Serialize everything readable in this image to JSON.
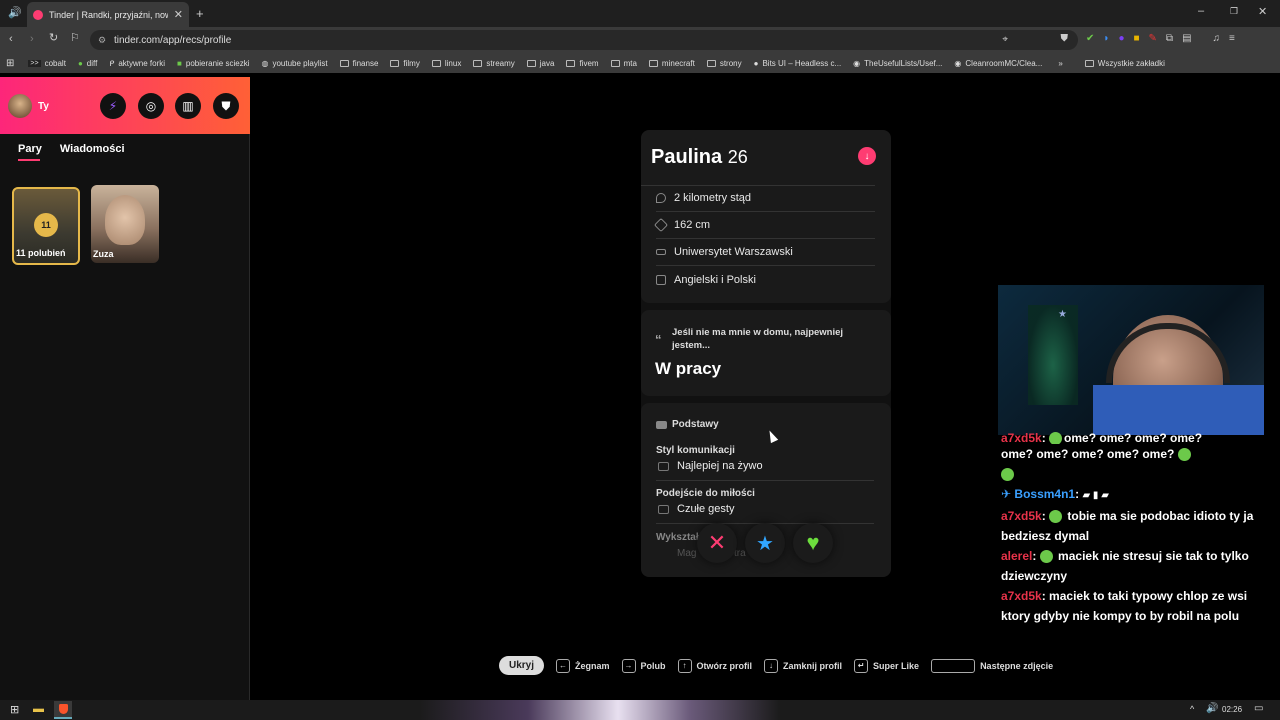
{
  "browser": {
    "tab_title": "Tinder | Randki, przyjaźni, nowe z",
    "url": "tinder.com/app/recs/profile",
    "bookmarks": [
      "cobalt",
      "diff",
      "aktywne forki",
      "pobieranie sciezki",
      "youtube playlist",
      "finanse",
      "filmy",
      "linux",
      "streamy",
      "java",
      "fivem",
      "mta",
      "minecraft",
      "strony",
      "Bits UI – Headless c...",
      "TheUsefulLists/Usef...",
      "CleanroomMC/Clea..."
    ],
    "all_bookmarks": "Wszystkie zakładki"
  },
  "sidebar": {
    "user_label": "Ty",
    "tabs": [
      "Pary",
      "Wiadomości"
    ],
    "likes_count": "11",
    "likes_label": "11 polubień",
    "match_name": "Zuza"
  },
  "profile": {
    "name": "Paulina",
    "age": "26",
    "details": [
      {
        "icon": "location-icon",
        "text": "2 kilometry stąd"
      },
      {
        "icon": "ruler-icon",
        "text": "162 cm"
      },
      {
        "icon": "school-icon",
        "text": "Uniwersytet Warszawski"
      },
      {
        "icon": "language-icon",
        "text": "Angielski i Polski"
      }
    ],
    "prompt_question": "Jeśli nie ma mnie w domu, najpewniej jestem...",
    "prompt_answer": "W pracy",
    "basics_title": "Podstawy",
    "basics": [
      {
        "label": "Styl komunikacji",
        "value": "Najlepiej na żywo"
      },
      {
        "label": "Podejście do miłości",
        "value": "Czułe gesty"
      }
    ],
    "partial_label": "Wykształ",
    "partial_value": "Mag",
    "partial_value_tail": "tra"
  },
  "hints": {
    "hide": "Ukryj",
    "nope": "Żegnam",
    "like": "Polub",
    "open": "Otwórz profil",
    "close": "Zamknij profil",
    "superlike": "Super Like",
    "next_photo": "Następne zdjęcie"
  },
  "chat": [
    {
      "user": "a7xd5k",
      "color": "#e8334a",
      "msg": "ome? ome? ome? ome?"
    },
    {
      "user": "",
      "color": "",
      "msg": "ome? ome? ome? ome? ome?"
    },
    {
      "user": "Bossm4n1",
      "color": "#3aa0ff",
      "msg": ""
    },
    {
      "user": "a7xd5k",
      "color": "#e8334a",
      "msg": "tobie ma sie podobac idioto ty ja bedziesz dymal"
    },
    {
      "user": "alerel",
      "color": "#e8334a",
      "msg": "maciek nie stresuj sie tak to tylko dziewczyny"
    },
    {
      "user": "a7xd5k",
      "color": "#e8334a",
      "msg": "maciek to taki typowy chlop ze wsi ktory gdyby nie kompy to by robil na polu"
    }
  ],
  "taskbar": {
    "time": "02:26"
  }
}
